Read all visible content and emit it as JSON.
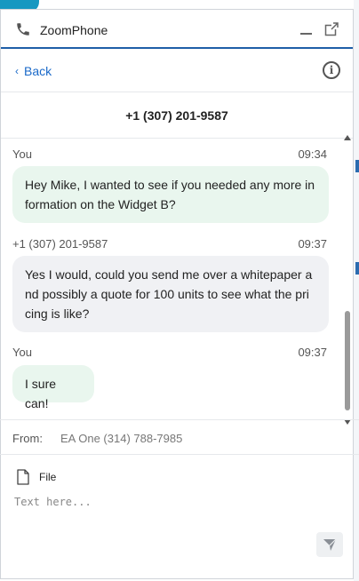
{
  "window": {
    "title": "ZoomPhone"
  },
  "nav": {
    "back_label": "Back"
  },
  "contact": {
    "number": "+1 (307) 201-9587"
  },
  "messages": [
    {
      "sender": "You",
      "time": "09:34",
      "text": "Hey Mike, I wanted to see if you needed any more in formation on the Widget B?",
      "direction": "outgoing"
    },
    {
      "sender": "+1 (307) 201-9587",
      "time": "09:37",
      "text": "Yes I would, could you send me over a whitepaper a nd possibly a quote for 100 units to see what the pri cing is like?",
      "direction": "incoming"
    },
    {
      "sender": "You",
      "time": "09:37",
      "text": "I sure can!",
      "direction": "outgoing"
    }
  ],
  "from": {
    "label": "From:",
    "value": "EA One (314) 788-7985"
  },
  "compose": {
    "file_label": "File",
    "placeholder": "Text here..."
  },
  "colors": {
    "accent": "#1f5fa8",
    "link": "#1b6ac9",
    "outgoing_bubble": "#e9f6ee",
    "incoming_bubble": "#f0f1f4"
  },
  "icons": [
    "phone-icon",
    "minimize-icon",
    "popout-icon",
    "chevron-left-icon",
    "info-icon",
    "file-icon",
    "send-icon"
  ]
}
